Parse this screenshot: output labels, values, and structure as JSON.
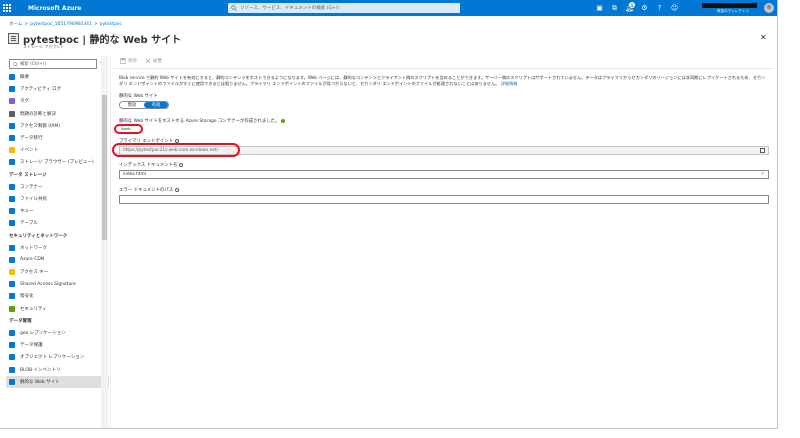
{
  "topbar": {
    "brand": "Microsoft Azure",
    "search_placeholder": "リソース、サービス、ドキュメントの検索 (G+/)",
    "notification_count": "1",
    "account_label": "既定のディレクトリ",
    "color": "#0078d4"
  },
  "breadcrumb": {
    "home": "ホーム",
    "resource_group": "pytestpoc_1651796960341",
    "current": "pytestpoc"
  },
  "header": {
    "title": "pytestpoc | 静的な Web サイト",
    "subtitle": "ストレージ アカウント"
  },
  "sidebar": {
    "search_placeholder": "検索 (Ctrl+/)",
    "items_top": [
      {
        "label": "概要",
        "icon": "overview-icon",
        "color": "#0078d4"
      },
      {
        "label": "アクティビティ ログ",
        "icon": "activity-log-icon",
        "color": "#0078d4"
      },
      {
        "label": "タグ",
        "icon": "tag-icon",
        "color": "#8661c5"
      },
      {
        "label": "問題の診断と解決",
        "icon": "wrench-icon",
        "color": "#605e5c"
      },
      {
        "label": "アクセス制御 (IAM)",
        "icon": "iam-icon",
        "color": "#0078d4"
      },
      {
        "label": "データ移行",
        "icon": "data-migration-icon",
        "color": "#0078d4"
      },
      {
        "label": "イベント",
        "icon": "event-icon",
        "color": "#ffb900"
      },
      {
        "label": "ストレージ ブラウザー (プレビュー)",
        "icon": "storage-browser-icon",
        "color": "#0078d4"
      }
    ],
    "section_data_storage": "データ ストレージ",
    "items_data_storage": [
      {
        "label": "コンテナー",
        "icon": "container-icon",
        "color": "#0078d4"
      },
      {
        "label": "ファイル共有",
        "icon": "file-share-icon",
        "color": "#0078d4"
      },
      {
        "label": "キュー",
        "icon": "queue-icon",
        "color": "#0078d4"
      },
      {
        "label": "テーブル",
        "icon": "table-icon",
        "color": "#0078d4"
      }
    ],
    "section_security": "セキュリティとネットワーク",
    "items_security": [
      {
        "label": "ネットワーク",
        "icon": "network-icon",
        "color": "#0078d4"
      },
      {
        "label": "Azure CDN",
        "icon": "cdn-icon",
        "color": "#0078d4"
      },
      {
        "label": "アクセス キー",
        "icon": "key-icon",
        "color": "#ffb900"
      },
      {
        "label": "Shared Access Signature",
        "icon": "sas-icon",
        "color": "#0078d4"
      },
      {
        "label": "暗号化",
        "icon": "lock-icon",
        "color": "#0078d4"
      },
      {
        "label": "セキュリティ",
        "icon": "shield-icon",
        "color": "#57a300"
      }
    ],
    "section_data_management": "データ管理",
    "items_data_management": [
      {
        "label": "geo レプリケーション",
        "icon": "globe-icon",
        "color": "#0078d4"
      },
      {
        "label": "データ保護",
        "icon": "data-protection-icon",
        "color": "#0078d4"
      },
      {
        "label": "オブジェクト レプリケーション",
        "icon": "object-replication-icon",
        "color": "#0078d4"
      },
      {
        "label": "BLOB インベントリ",
        "icon": "blob-inventory-icon",
        "color": "#0078d4"
      },
      {
        "label": "静的な Web サイト",
        "icon": "static-website-icon",
        "color": "#0078d4",
        "active": true
      }
    ]
  },
  "toolbar": {
    "save_label": "保存",
    "discard_label": "破棄"
  },
  "content": {
    "description": "Blob service で静的 Web サイトを有効にすると、静的コンテンツをホストできるようになります。Web ページには、静的なコンテンツとクライアント側のスクリプトを含めることができます。サーバー側のスクリプトはサポートされていません。データはプライマリからセカンダリのリージョンには非同期にレプリケートされるため、セカンダリ エンドポイントのファイルがすぐに使用できるとは限りません。プライマリ エンドポイントのファイルが見つからないと、セカンダリ エンドポイントのファイルが処理されないことはありません。",
    "learn_more": "詳細情報",
    "static_website_label": "静的な Web サイト",
    "toggle_disabled": "無効",
    "toggle_enabled": "有効",
    "status_text": "静的な Web サイトをホストする Azure Storage コンテナーが作成されました。",
    "container_name": "$web",
    "primary_endpoint_label": "プライマリ エンドポイント",
    "primary_endpoint_value": "https://pytestpoc21z.web.core.windows.net/",
    "index_doc_label": "インデックス ドキュメント名",
    "index_doc_value": "index.html",
    "error_doc_label": "エラー ドキュメントのパス",
    "error_doc_value": ""
  },
  "highlight_color": "#e81123"
}
